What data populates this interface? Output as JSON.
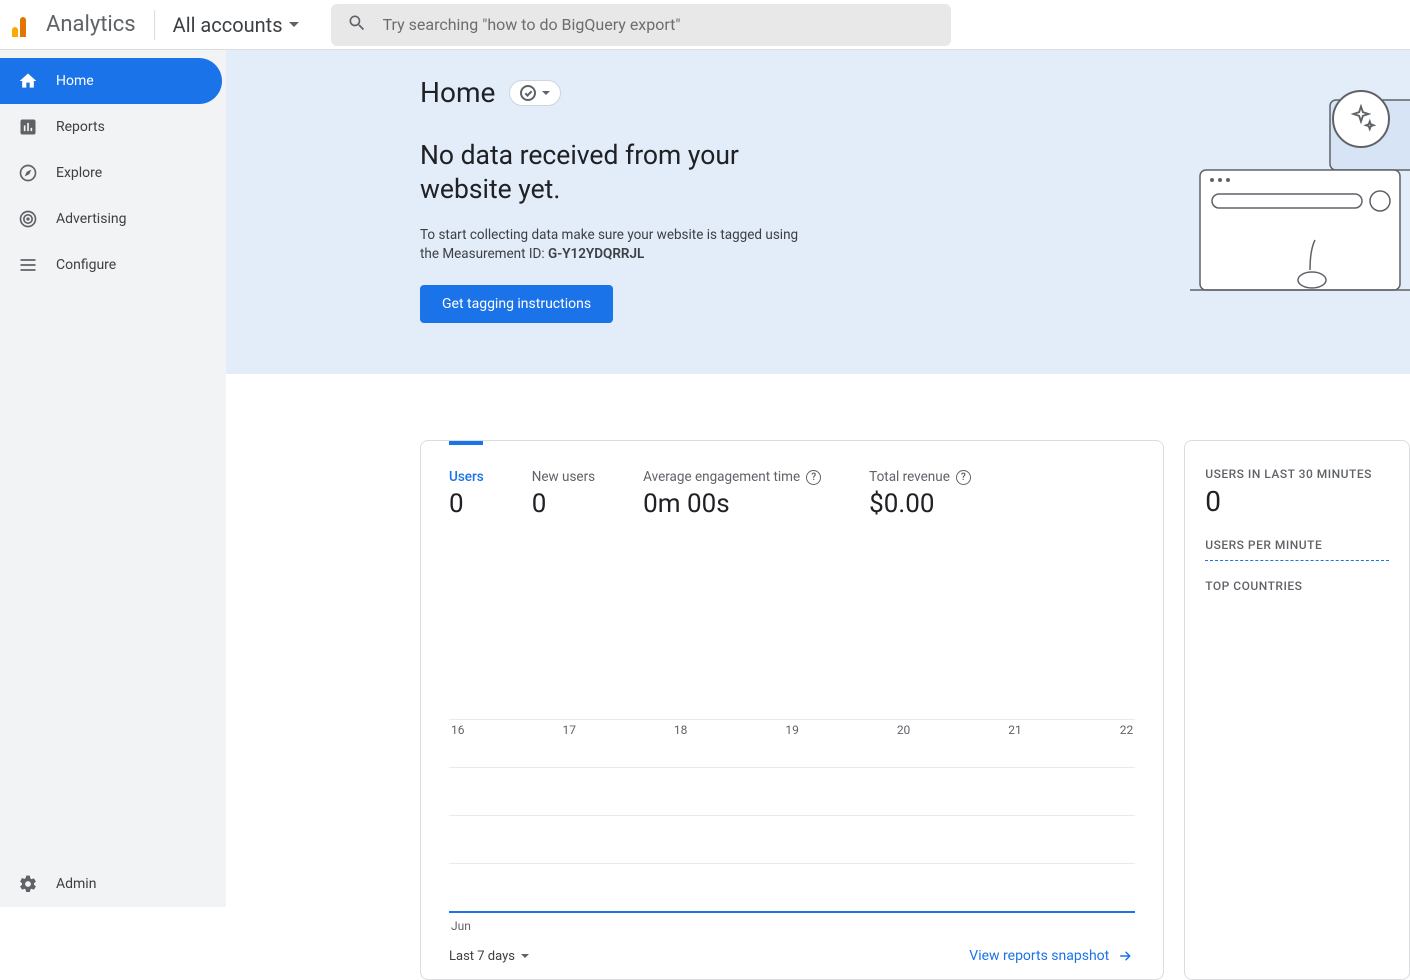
{
  "header": {
    "product": "Analytics",
    "account_label": "All accounts",
    "search_placeholder": "Try searching \"how to do BigQuery export\""
  },
  "sidebar": {
    "items": [
      {
        "label": "Home"
      },
      {
        "label": "Reports"
      },
      {
        "label": "Explore"
      },
      {
        "label": "Advertising"
      },
      {
        "label": "Configure"
      }
    ],
    "admin_label": "Admin"
  },
  "hero": {
    "title": "Home",
    "heading": "No data received from your website yet.",
    "subtext_prefix": "To start collecting data make sure your website is tagged using the Measurement ID: ",
    "measurement_id": "G-Y12YDQRRJL",
    "cta": "Get tagging instructions"
  },
  "metrics": [
    {
      "label": "Users",
      "value": "0",
      "active": true,
      "help": false
    },
    {
      "label": "New users",
      "value": "0",
      "active": false,
      "help": false
    },
    {
      "label": "Average engagement time",
      "value": "0m 00s",
      "active": false,
      "help": true
    },
    {
      "label": "Total revenue",
      "value": "$0.00",
      "active": false,
      "help": true
    }
  ],
  "chart": {
    "x_labels": [
      "16",
      "17",
      "18",
      "19",
      "20",
      "21",
      "22"
    ],
    "x_sub": "Jun",
    "range_label": "Last 7 days",
    "snapshot_link": "View reports snapshot"
  },
  "realtime": {
    "last30_label": "USERS IN LAST 30 MINUTES",
    "last30_value": "0",
    "per_minute_label": "USERS PER MINUTE",
    "top_countries_label": "TOP COUNTRIES"
  },
  "chart_data": {
    "type": "line",
    "title": "Users",
    "xlabel": "Jun",
    "ylabel": "",
    "categories": [
      "16",
      "17",
      "18",
      "19",
      "20",
      "21",
      "22"
    ],
    "series": [
      {
        "name": "Users",
        "values": [
          0,
          0,
          0,
          0,
          0,
          0,
          0
        ]
      }
    ],
    "ylim": [
      0,
      0
    ]
  }
}
